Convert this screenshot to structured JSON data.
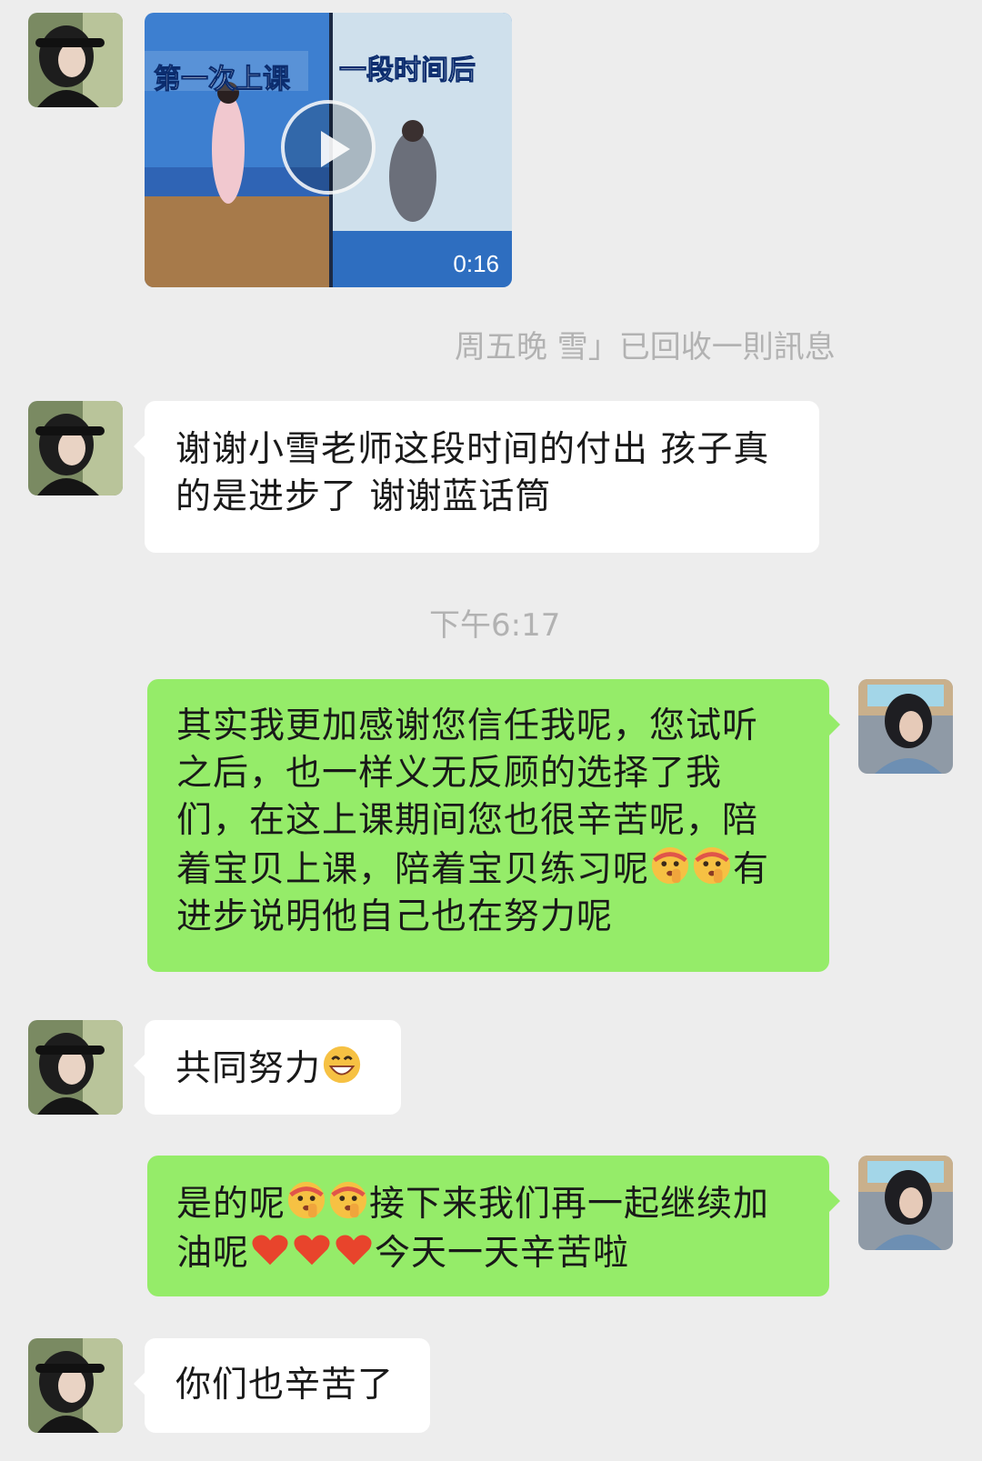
{
  "video_message": {
    "overlay_left": "第一次上课",
    "overlay_right": "一段时间后",
    "duration": "0:16"
  },
  "recall_notice": "周五晚 雪」已回收一則訊息",
  "time_separator": "下午6:17",
  "messages": [
    {
      "side": "left",
      "lines": [
        "谢谢小雪老师这段时间的付出 孩子真",
        "的是进步了 谢谢蓝话筒"
      ]
    },
    {
      "side": "right",
      "lines": [
        "其实我更加感谢您信任我呢，您试听",
        "之后，也一样义无反顾的选择了我",
        "们，在这上课期间您也很辛苦呢，陪",
        "着宝贝上课，陪着宝贝练习呢",
        "进步说明他自己也在努力呢"
      ],
      "line4_tail": "有"
    },
    {
      "side": "left",
      "text": "共同努力"
    },
    {
      "side": "right",
      "l1a": "是的呢",
      "l1b": "接下来我们再一起继续加",
      "l2a": "油呢",
      "l2b": "今天一天辛苦啦"
    },
    {
      "side": "left",
      "text": "你们也辛苦了"
    }
  ],
  "icons": {
    "emoji_shush": "shushing-face-icon",
    "emoji_grin": "grinning-face-icon",
    "emoji_heart": "red-heart-icon",
    "play": "play-icon"
  },
  "colors": {
    "background": "#ededed",
    "incoming_bubble": "#ffffff",
    "outgoing_bubble": "#95ec69",
    "system_text": "#b2b2b2"
  }
}
